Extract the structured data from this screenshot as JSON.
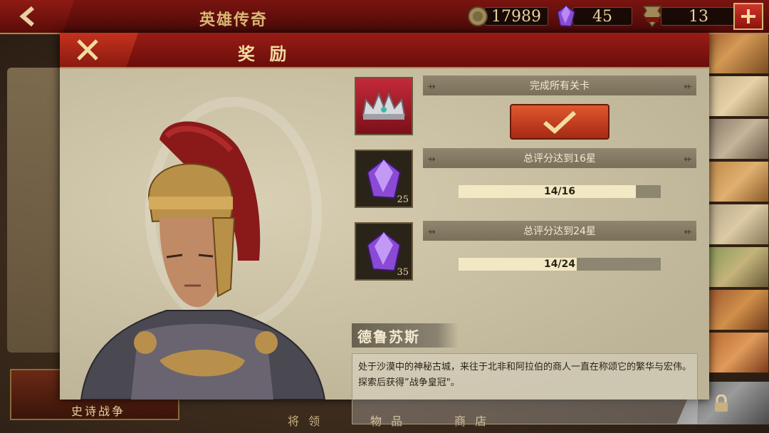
{
  "header": {
    "title": "英雄传奇",
    "coins": "17989",
    "gems": "45",
    "spqr_count": "13"
  },
  "dialog": {
    "title": "奖 励",
    "rewards": [
      {
        "icon": "crown-icon",
        "label": "完成所有关卡",
        "count": "",
        "status": "claimable"
      },
      {
        "icon": "purple-gem-icon",
        "label": "总评分达到16星",
        "count": "25",
        "progress_text": "14/16",
        "progress": 0.875
      },
      {
        "icon": "purple-gem-icon",
        "label": "总评分达到24星",
        "count": "35",
        "progress_text": "14/24",
        "progress": 0.583
      }
    ],
    "location": {
      "name": "德鲁苏斯",
      "description": "处于沙漠中的神秘古城，来往于北非和阿拉伯的商人一直在称颂它的繁华与宏伟。探索后获得”战争皇冠\"。"
    }
  },
  "bottom_tabs": {
    "epic": "史诗战争",
    "generals": "将 领",
    "items": "物 品",
    "shop": "商 店"
  },
  "colors": {
    "accent_red": "#9a1c16",
    "gold": "#d9b874",
    "panel": "#c8bfa3"
  }
}
